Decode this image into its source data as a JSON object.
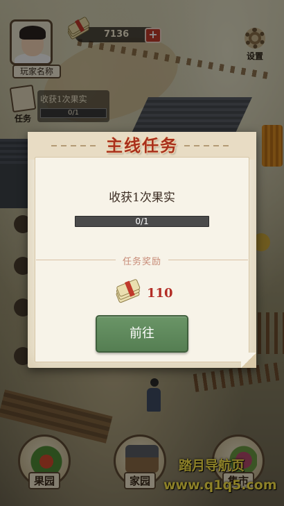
{
  "hud": {
    "player_name": "玩家名称",
    "money": "7136",
    "plus_label": "+",
    "settings_label": "设置",
    "task_label": "任务",
    "tracker": {
      "title": "收获1次果实",
      "progress_text": "0/1"
    }
  },
  "bottom_nav": {
    "orchard": "果园",
    "home": "家园",
    "market": "集市"
  },
  "watermark": {
    "title": "踏月导航页",
    "url": "www.q1q5.com"
  },
  "dialog": {
    "title": "主线任务",
    "quest_name": "收获1次果实",
    "progress_text": "0/1",
    "progress_fraction": 0,
    "reward_label": "任务奖励",
    "reward_value": "110",
    "go_button": "前往"
  },
  "colors": {
    "title_red": "#a8301c",
    "reward_red": "#b32d26",
    "button_green": "#6a9567"
  }
}
